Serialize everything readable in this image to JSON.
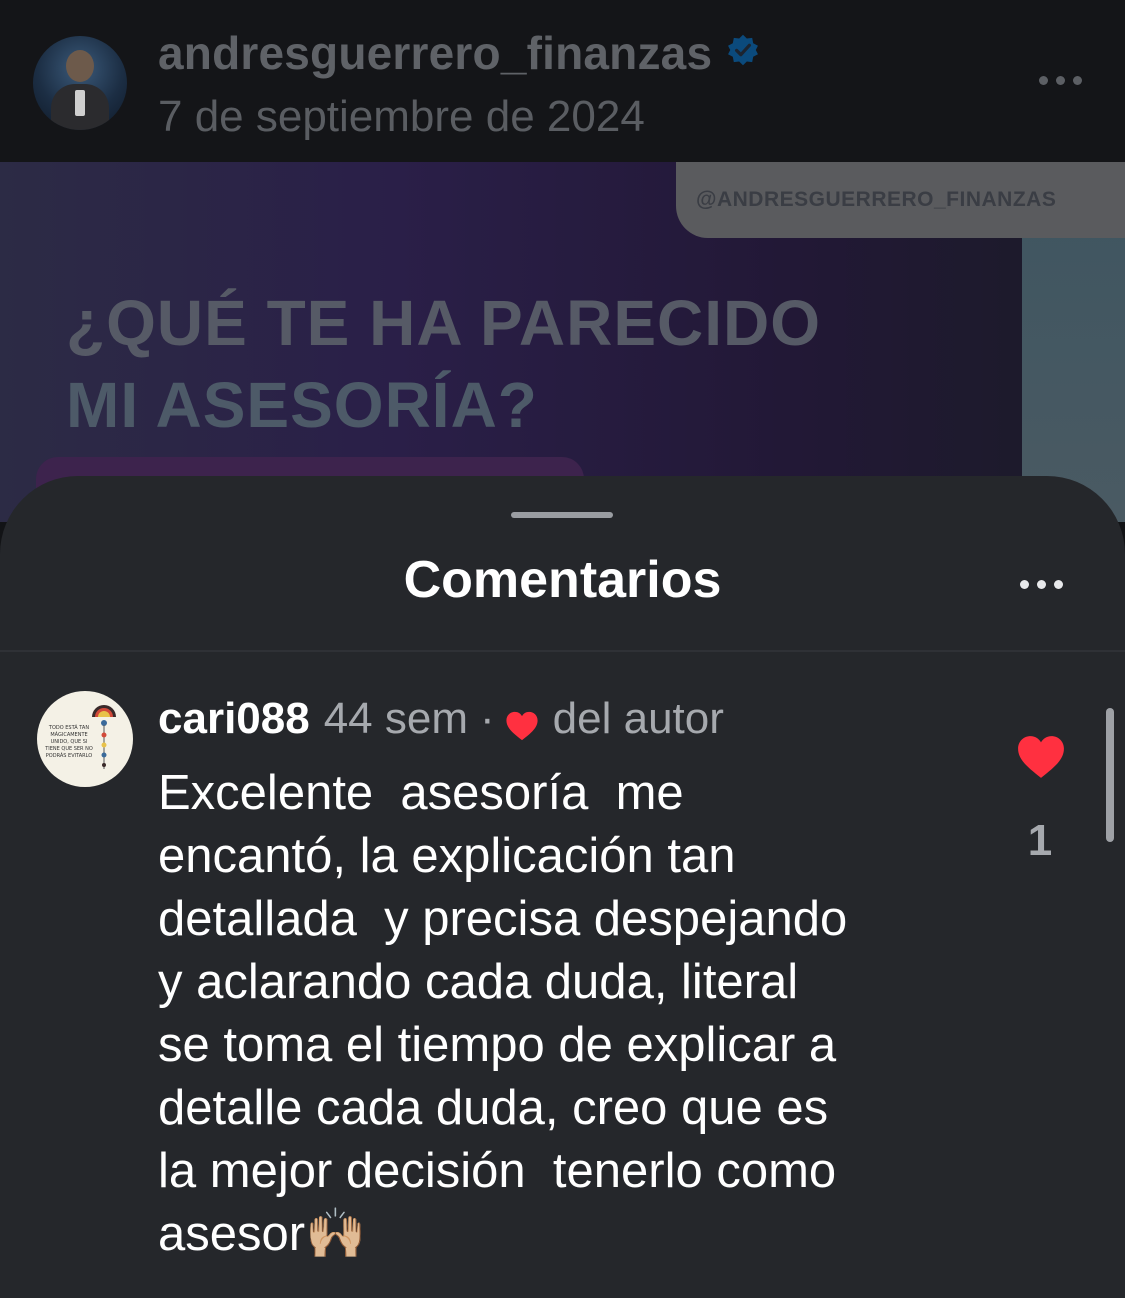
{
  "header": {
    "username": "andresguerrero_finanzas",
    "date": "7 de septiembre de 2024",
    "verified_color": "#0095f6"
  },
  "post": {
    "handle": "@ANDRESGUERRERO_FINANZAS",
    "title_line1": "¿QUÉ TE HA PARECIDO",
    "title_line2": "MI ASESORÍA?"
  },
  "sheet": {
    "title": "Comentarios"
  },
  "comment": {
    "username": "cari088",
    "time": "44 sem",
    "separator": "·",
    "author_like_label": "del autor",
    "text": "Excelente  asesoría  me\nencantó, la explicación tan\ndetallada  y precisa despejando\ny aclarando cada duda, literal\nse toma el tiempo de explicar a\ndetalle cada duda, creo que es\nla mejor decisión  tenerlo como\nasesor🙌🏼",
    "like_count": "1",
    "avatar_text": "TODO ESTÁ TAN MÁGICAMENTE UNIDO, QUE SI TIENE QUE SER NO PODRÁS EVITARLO",
    "heart_color": "#ff3040"
  },
  "icons": {
    "verified": "verified-badge-icon",
    "more": "more-options-icon",
    "heart": "heart-icon"
  }
}
